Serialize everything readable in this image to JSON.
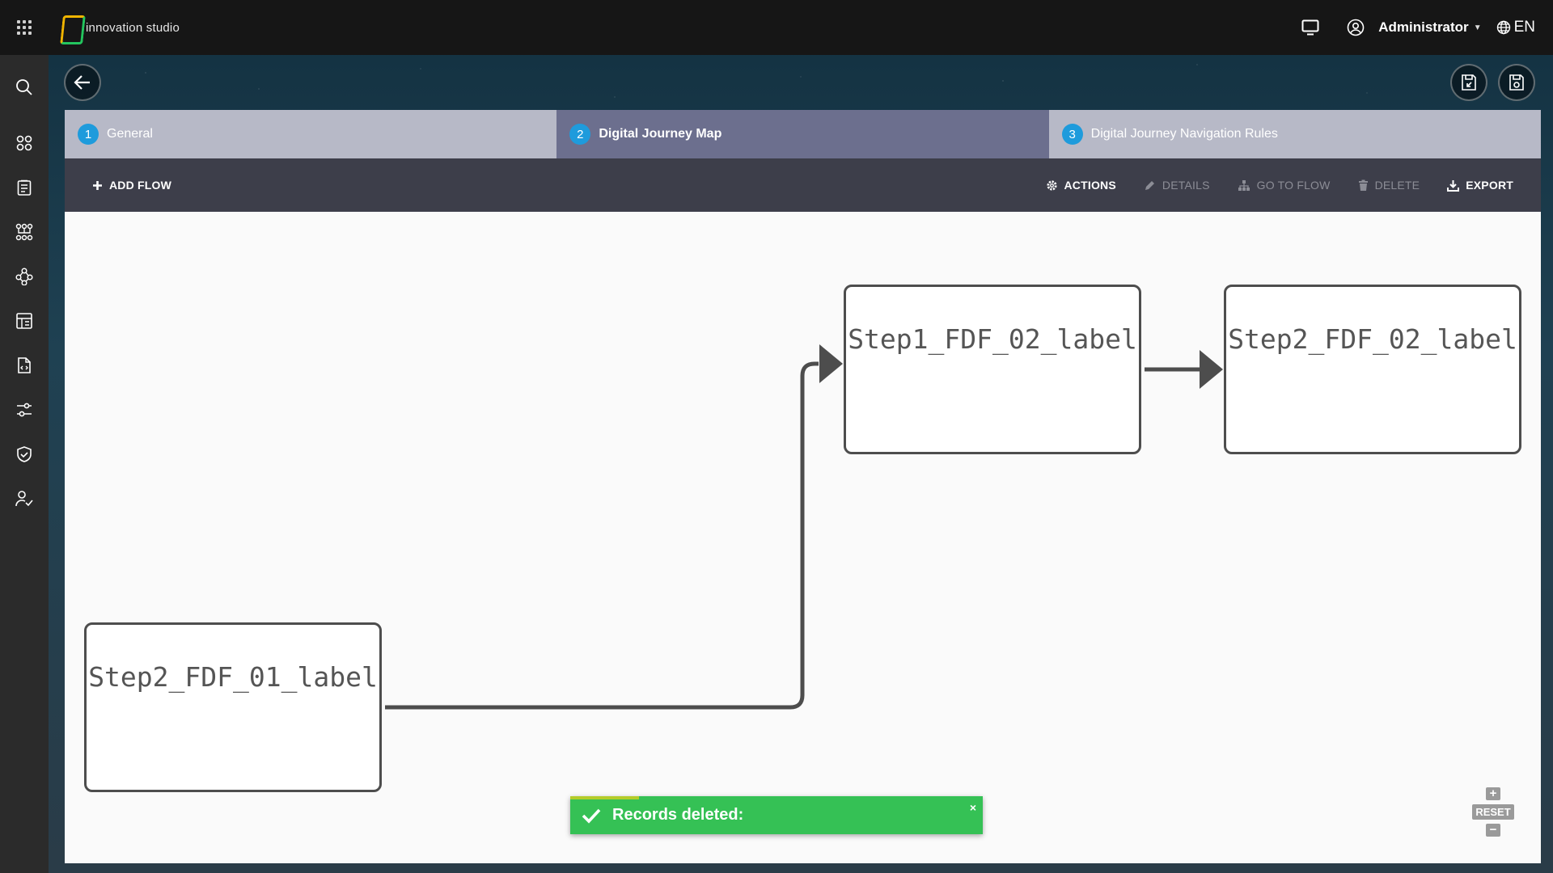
{
  "app": {
    "brand_name": "innovation studio",
    "user_name": "Administrator",
    "language": "EN"
  },
  "wizard": {
    "steps": [
      {
        "number": "1",
        "label": "General",
        "state": "inactive"
      },
      {
        "number": "2",
        "label": "Digital Journey Map",
        "state": "active"
      },
      {
        "number": "3",
        "label": "Digital Journey Navigation Rules",
        "state": "inactive"
      }
    ]
  },
  "actions": {
    "add_flow": "ADD FLOW",
    "actions": "ACTIONS",
    "details": "DETAILS",
    "go_to_flow": "GO TO FLOW",
    "delete": "DELETE",
    "export": "EXPORT"
  },
  "diagram": {
    "nodes": [
      {
        "id": "n1",
        "label": "Step2_FDF_01_label"
      },
      {
        "id": "n2",
        "label": "Step1_FDF_02_label"
      },
      {
        "id": "n3",
        "label": "Step2_FDF_02_label"
      }
    ],
    "edges": [
      {
        "from": "n1",
        "to": "n2"
      },
      {
        "from": "n2",
        "to": "n3"
      }
    ]
  },
  "toast": {
    "message": "Records deleted:",
    "close": "×"
  },
  "zoom": {
    "plus": "+",
    "reset": "RESET",
    "minus": "−"
  },
  "colors": {
    "accent_blue": "#1e9bdc",
    "success_green": "#35c155",
    "active_step": "#6c6f8e",
    "inactive_step": "#b7b9c7"
  }
}
